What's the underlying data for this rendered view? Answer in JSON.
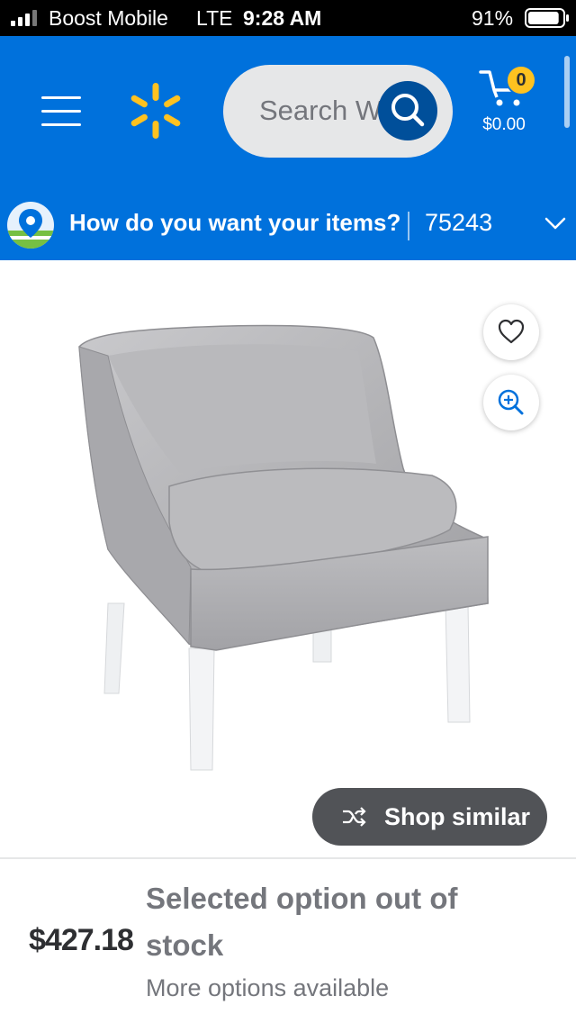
{
  "status_bar": {
    "carrier": "Boost Mobile",
    "network": "LTE",
    "time": "9:28 AM",
    "battery_percent": "91%",
    "battery_level": 0.91
  },
  "header": {
    "search_placeholder": "Search Walmart",
    "cart_count": "0",
    "cart_total": "$0.00",
    "colors": {
      "primary": "#0071dc",
      "spark": "#ffc220",
      "search_button": "#004f9a"
    }
  },
  "location_bar": {
    "question": "How do you want your items?",
    "zip": "75243"
  },
  "product": {
    "image_alt": "grey velvet accent chair",
    "shop_similar_label": "Shop similar",
    "price": "$427.18",
    "availability_line1": "Selected option out of",
    "availability_line2": "stock",
    "more_options": "More options available"
  },
  "icons": [
    "signal-icon",
    "battery-icon",
    "menu-icon",
    "spark-logo-icon",
    "search-icon",
    "cart-icon",
    "location-pin-icon",
    "chevron-down-icon",
    "heart-icon",
    "zoom-in-icon",
    "shuffle-icon"
  ]
}
